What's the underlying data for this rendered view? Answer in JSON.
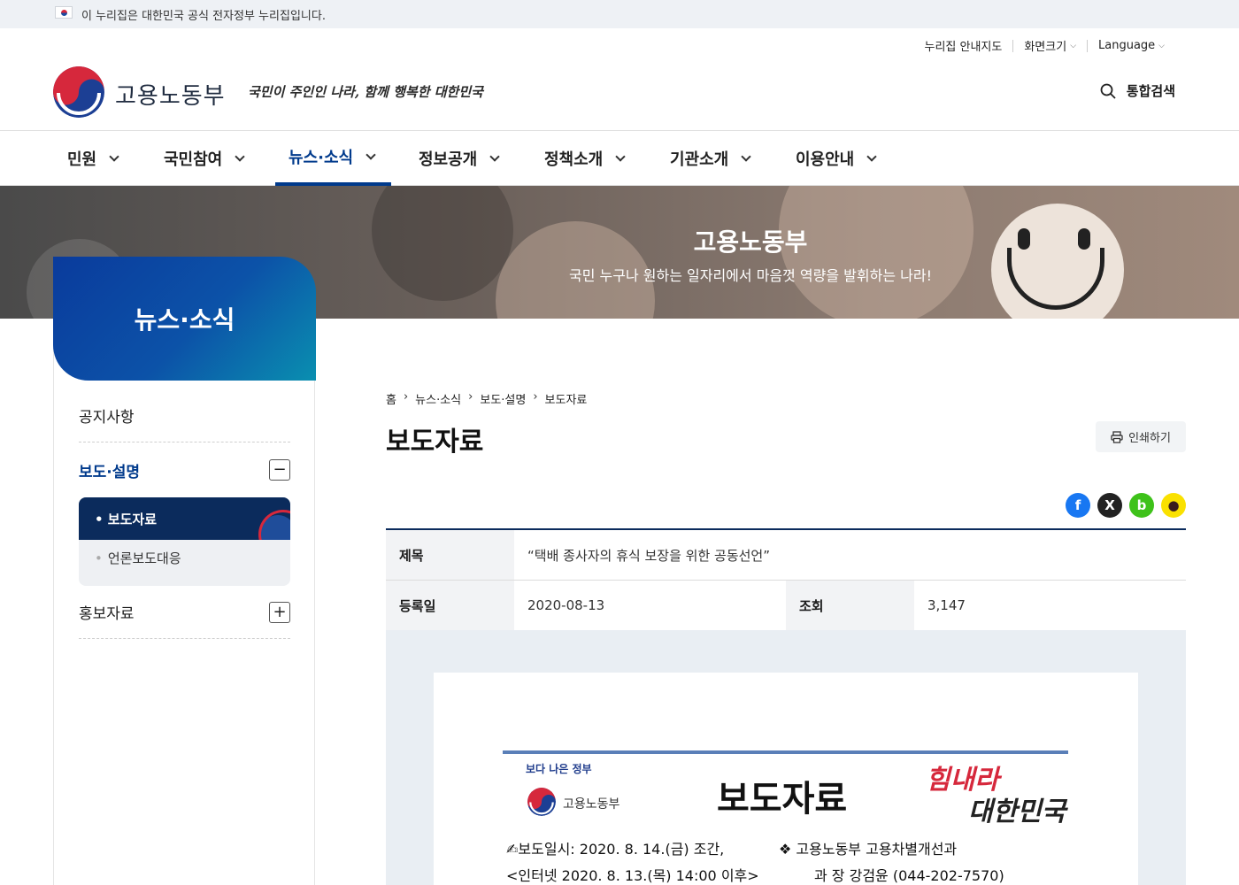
{
  "gov_banner": {
    "text": "이 누리집은 대한민국 공식 전자정부 누리집입니다."
  },
  "utility": {
    "sitemap": "누리집 안내지도",
    "zoom": "화면크기",
    "language": "Language"
  },
  "header": {
    "brand": "고용노동부",
    "slogan": "국민이 주인인 나라, 함께 행복한 대한민국",
    "search": "통합검색"
  },
  "gnb": {
    "items": [
      {
        "label": "민원"
      },
      {
        "label": "국민참여"
      },
      {
        "label": "뉴스·소식"
      },
      {
        "label": "정보공개"
      },
      {
        "label": "정책소개"
      },
      {
        "label": "기관소개"
      },
      {
        "label": "이용안내"
      }
    ],
    "active": "뉴스·소식"
  },
  "hero": {
    "title": "고용노동부",
    "subtitle": "국민 누구나 원하는 일자리에서 마음껏 역량을 발휘하는 나라!"
  },
  "sidebar": {
    "title": "뉴스·소식",
    "items": [
      {
        "label": "공지사항"
      },
      {
        "label": "보도·설명",
        "toggle": "−"
      },
      {
        "label": "홍보자료",
        "toggle": "+"
      }
    ],
    "sub_items": [
      {
        "label": "• 보도자료"
      },
      {
        "label": "언론보도대응"
      }
    ]
  },
  "breadcrumb": [
    "홈",
    "뉴스·소식",
    "보도·설명",
    "보도자료"
  ],
  "page_title": "보도자료",
  "print_label": "인쇄하기",
  "share": {
    "facebook": "f",
    "x": "X",
    "band": "b",
    "kakao": "●"
  },
  "detail": {
    "subject_label": "제목",
    "subject": "“택배 종사자의 휴식 보장을 위한 공동선언”",
    "date_label": "등록일",
    "date": "2020-08-13",
    "views_label": "조회",
    "views": "3,147"
  },
  "document": {
    "better_gov": "보다 나은 정부",
    "ministry": "고용노동부",
    "heading": "보도자료",
    "callig_top": "힘내라",
    "callig_bottom": "대한민국",
    "release": "✍보도일시: 2020. 8. 14.(금) 조간,",
    "internet": "<인터넷 2020. 8. 13.(목) 14:00 이후>",
    "dept": "❖ 고용노동부 고용차별개선과",
    "contact": "과  장 강검윤 (044-202-7570)"
  }
}
